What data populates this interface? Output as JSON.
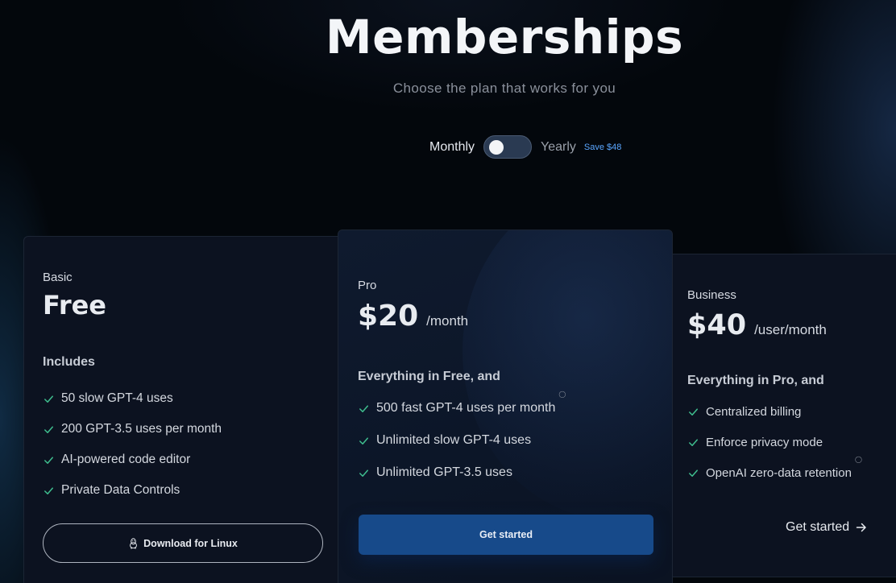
{
  "header": {
    "title": "Memberships",
    "subtitle": "Choose the plan that works for you"
  },
  "billing": {
    "monthly_label": "Monthly",
    "yearly_label": "Yearly",
    "save_badge": "Save $48",
    "selected": "Monthly"
  },
  "colors": {
    "accent": "#5aa6ff",
    "check": "#3fbf8f",
    "primary_button": "#174a8a"
  },
  "plans": {
    "basic": {
      "name": "Basic",
      "price": "Free",
      "section_head": "Includes",
      "features": [
        "50 slow GPT-4 uses",
        "200 GPT-3.5 uses per month",
        "AI-powered code editor",
        "Private Data Controls"
      ],
      "button": "Download for Linux",
      "button_icon": "linux-icon"
    },
    "pro": {
      "name": "Pro",
      "price": "$20",
      "period": "/month",
      "section_head": "Everything in Free, and",
      "features": [
        "500 fast GPT-4 uses per month",
        "Unlimited slow GPT-4 uses",
        "Unlimited GPT-3.5 uses"
      ],
      "button": "Get started"
    },
    "business": {
      "name": "Business",
      "price": "$40",
      "period": "/user/month",
      "section_head": "Everything in Pro, and",
      "features": [
        "Centralized billing",
        "Enforce privacy mode",
        "OpenAI zero-data retention"
      ],
      "button": "Get started",
      "button_icon": "arrow-right-icon"
    }
  }
}
